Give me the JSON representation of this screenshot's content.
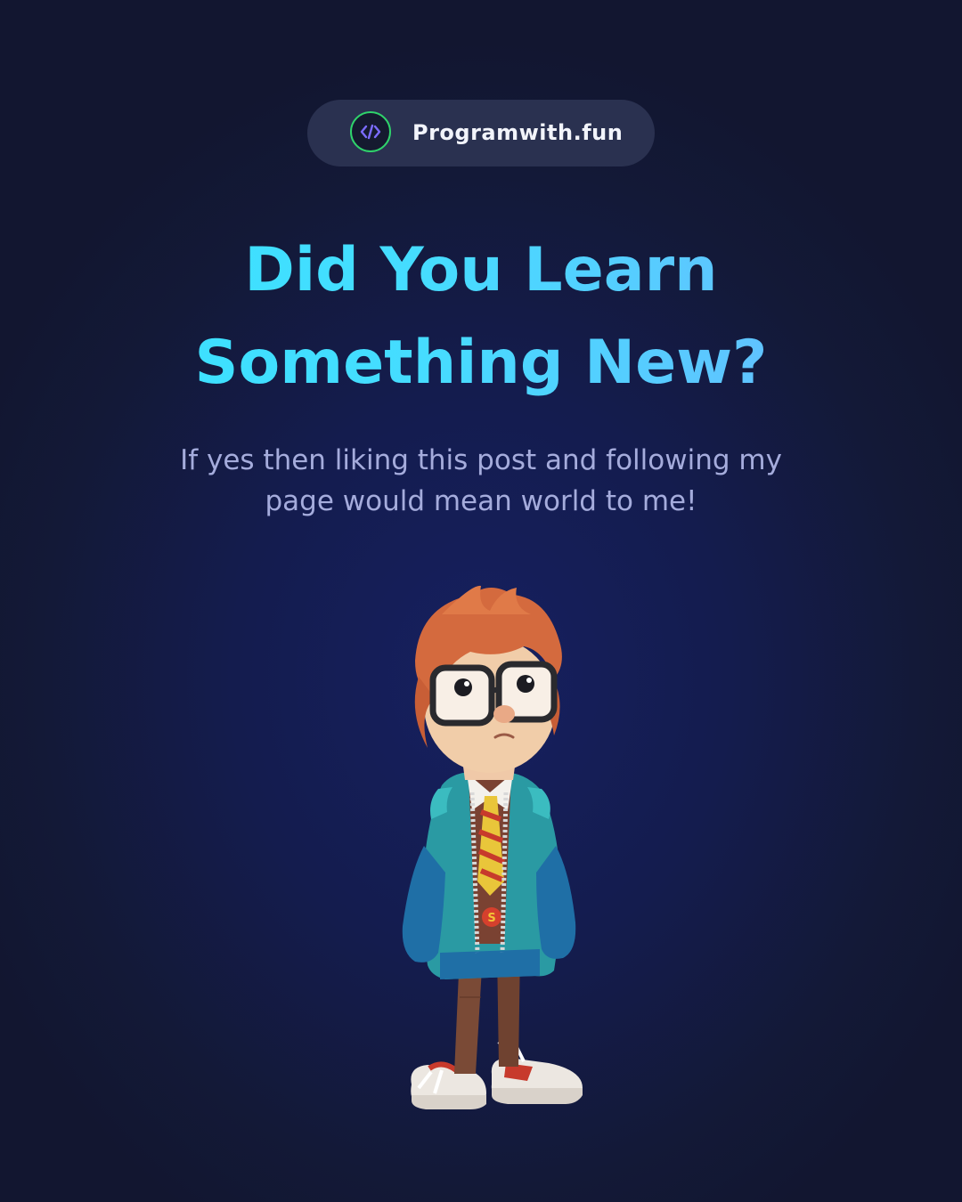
{
  "brand": {
    "name": "Programwith.fun",
    "logo_icon": "code-brackets-icon",
    "logo_ring_color": "#2fd36b",
    "logo_glyph_color": "#7c6cff"
  },
  "headline": {
    "line1": "Did You Learn",
    "line2": "Something New?",
    "color": "#3de0ff"
  },
  "message": {
    "line1": "If yes then liking this post and following my",
    "line2": "page would mean world to me!"
  },
  "illustration": {
    "icon": "cartoon-boy-with-glasses-illustration"
  },
  "colors": {
    "background": "#141a45",
    "pill_background": "#2a3150",
    "subtitle": "#a5acdc"
  }
}
